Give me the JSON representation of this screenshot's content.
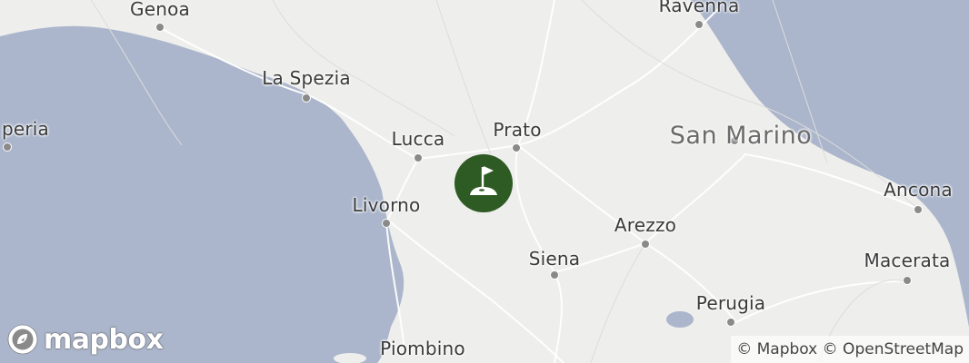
{
  "map": {
    "colors": {
      "land": "#eeeeec",
      "water": "#abb6cc",
      "roads": "#ffffff",
      "marker": "#2e5b24"
    },
    "places": [
      {
        "id": "genoa",
        "label": "Genoa"
      },
      {
        "id": "la-spezia",
        "label": "La Spezia"
      },
      {
        "id": "speria",
        "label": "peria"
      },
      {
        "id": "lucca",
        "label": "Lucca"
      },
      {
        "id": "prato",
        "label": "Prato"
      },
      {
        "id": "ravenna",
        "label": "Ravenna"
      },
      {
        "id": "san-marino",
        "label": "San Marino"
      },
      {
        "id": "livorno",
        "label": "Livorno"
      },
      {
        "id": "arezzo",
        "label": "Arezzo"
      },
      {
        "id": "siena",
        "label": "Siena"
      },
      {
        "id": "ancona",
        "label": "Ancona"
      },
      {
        "id": "macerata",
        "label": "Macerata"
      },
      {
        "id": "perugia",
        "label": "Perugia"
      },
      {
        "id": "piombino",
        "label": "Piombino"
      }
    ],
    "marker_icon": "golf-flag-icon"
  },
  "logo": {
    "text": "mapbox",
    "icon": "mapbox-logo-icon"
  },
  "attribution": {
    "mapbox": "© Mapbox",
    "osm": "© OpenStreetMap"
  }
}
